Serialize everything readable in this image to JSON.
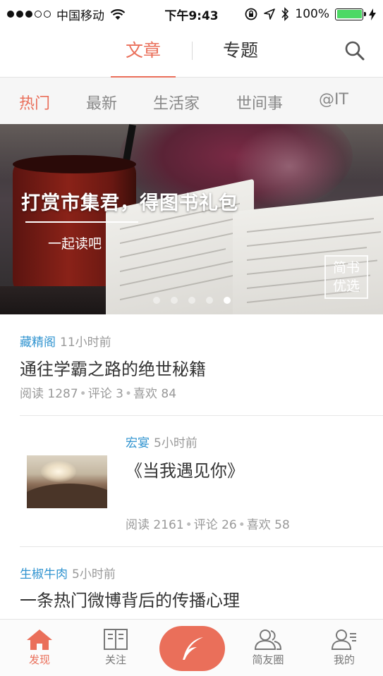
{
  "status_bar": {
    "carrier": "中国移动",
    "time": "下午9:43",
    "battery": "100%",
    "signal_bars": 3,
    "battery_level": 1.0
  },
  "top_nav": {
    "tabs": [
      {
        "label": "文章",
        "active": true
      },
      {
        "label": "专题",
        "active": false
      }
    ],
    "search_icon": "search-icon"
  },
  "categories": [
    {
      "label": "热门",
      "active": true
    },
    {
      "label": "最新",
      "active": false
    },
    {
      "label": "生活家",
      "active": false
    },
    {
      "label": "世间事",
      "active": false
    },
    {
      "label": "@IT",
      "active": false
    }
  ],
  "banner": {
    "title": "打赏市集君，得图书礼包",
    "subtitle": "一起读吧",
    "badge_line1": "简书",
    "badge_line2": "优选",
    "page_count": 5,
    "active_page": 4
  },
  "feed": [
    {
      "author": "藏精阁",
      "time": "11小时前",
      "title": "通往学霸之路的绝世秘籍",
      "reads": "阅读 1287",
      "comments": "评论 3",
      "likes": "喜欢 84",
      "has_thumbnail": false
    },
    {
      "author": "宏宴",
      "time": "5小时前",
      "title": "《当我遇见你》",
      "reads": "阅读 2161",
      "comments": "评论 26",
      "likes": "喜欢 58",
      "has_thumbnail": true
    },
    {
      "author": "生椒牛肉",
      "time": "5小时前",
      "title": "一条热门微博背后的传播心理",
      "has_thumbnail": false
    }
  ],
  "tab_bar": {
    "items": [
      {
        "label": "发现",
        "icon": "home-icon",
        "active": true
      },
      {
        "label": "关注",
        "icon": "book-icon",
        "active": false
      },
      {
        "label": "",
        "icon": "quill-icon",
        "active": false
      },
      {
        "label": "简友圈",
        "icon": "friends-icon",
        "active": false
      },
      {
        "label": "我的",
        "icon": "profile-icon",
        "active": false
      }
    ]
  },
  "colors": {
    "accent": "#ea6f5a",
    "author_link": "#3194d0",
    "muted_text": "#999999",
    "battery_green": "#4cd964"
  }
}
